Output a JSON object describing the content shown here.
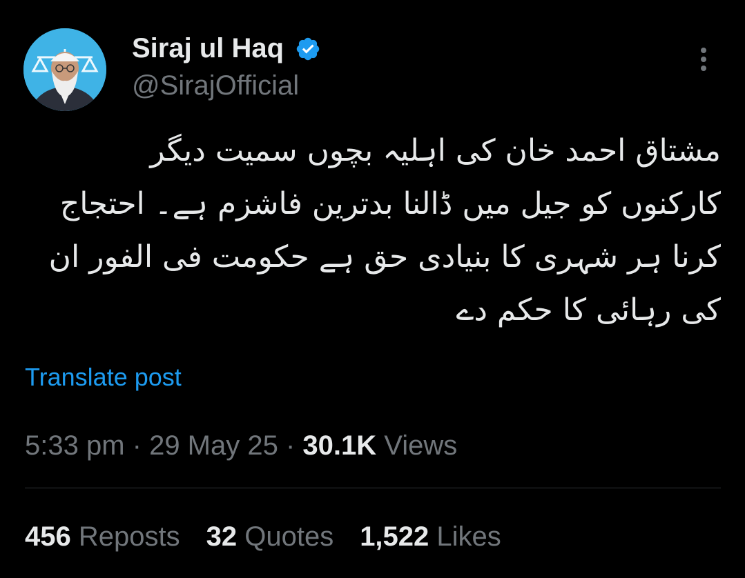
{
  "author": {
    "display_name": "Siraj ul Haq",
    "handle": "@SirajOfficial",
    "verified_color": "#1d9bf0",
    "avatar_icon": "profile-photo"
  },
  "tweet": {
    "lines": [
      "مشتاق احمد خان کی اہلیہ بچوں سمیت دیگر",
      "کارکنوں کو جیل میں ڈالنا بدترین فاشزم ہے۔ احتجاج",
      "کرنا ہر شہری کا بنیادی حق ہے حکومت فی الفور ان",
      "کی رہائی کا حکم دے"
    ],
    "translate_label": "Translate post"
  },
  "meta": {
    "time": "5:33 pm",
    "sep1": " · ",
    "date": "29 May 25",
    "sep2": " · ",
    "views_count": "30.1K",
    "views_label": " Views"
  },
  "stats": [
    {
      "count": "456",
      "label": " Reposts"
    },
    {
      "count": "32",
      "label": " Quotes"
    },
    {
      "count": "1,522",
      "label": " Likes"
    }
  ],
  "colors": {
    "background": "#000000",
    "primary_text": "#e7e9ea",
    "secondary_text": "#71767b",
    "accent": "#1d9bf0"
  }
}
